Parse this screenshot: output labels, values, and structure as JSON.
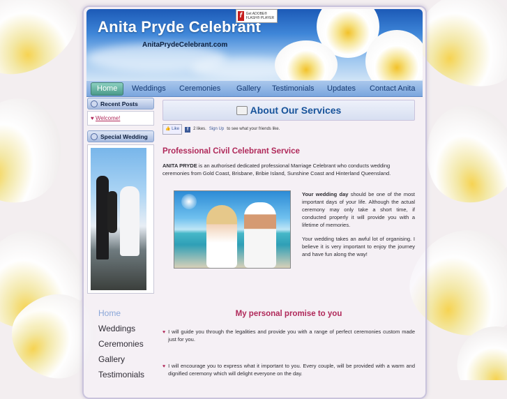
{
  "header": {
    "title": "Anita Pryde Celebrant",
    "url": "AnitaPrydeCelebrant.com",
    "flash_badge": "Get ADOBE® FLASH® PLAYER"
  },
  "nav": {
    "items": [
      "Home",
      "Weddings",
      "Ceremonies",
      "Gallery",
      "Testimonials",
      "Updates",
      "Contact Anita"
    ],
    "active": "Home"
  },
  "sidebar": {
    "recent_posts_title": "Recent Posts",
    "recent_posts": [
      "Welcome!"
    ],
    "special_wedding_title": "Special Wedding"
  },
  "side_nav": [
    "Home",
    "Weddings",
    "Ceremonies",
    "Gallery",
    "Testimonials"
  ],
  "content": {
    "title": "About Our Services",
    "fb": {
      "like": "Like",
      "count_text": "2 likes.",
      "sign_up": "Sign Up",
      "after": "to see what your friends like."
    },
    "section_title": "Professional Civil Celebrant Service",
    "intro_name": "ANITA PRYDE",
    "intro_rest": "is an authorised dedicated professional Marriage Celebrant who conducts wedding ceremonies from Gold Coast, Brisbane, Bribie Island, Sunshine Coast and Hinterland Queensland.",
    "p1_bold": "Your wedding day",
    "p1_rest": "should be one of the most important days of your life. Although the actual ceremony may only take a short time, if conducted properly it will provide you with a lifetime of memories.",
    "p2": "Your wedding takes an awful lot of organising. I believe it is very important to enjoy the journey and have fun along the way!",
    "promise_title": "My personal promise to you",
    "bullets": [
      "I will guide you through the legalities and provide you with a range of perfect ceremonies custom made just for you.",
      "I will encourage you to express what it important to you. Every couple, will be provided with a warm and dignified ceremony which will delight everyone on the day."
    ]
  },
  "colors": {
    "accent": "#b0295a",
    "title_blue": "#17539a",
    "nav_text": "#163a72"
  }
}
